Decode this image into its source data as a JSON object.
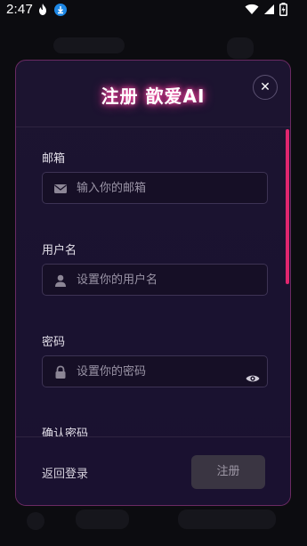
{
  "status_bar": {
    "time": "2:47",
    "app_icon": "flame-app-icon",
    "badge_icon": "download-badge-icon",
    "wifi_icon": "wifi-icon",
    "signal_icon": "cellular-signal-icon",
    "battery_icon": "battery-charging-icon"
  },
  "modal": {
    "title": "注册 歆爱AI",
    "close_label": "✕",
    "accent_color": "#ff2d95",
    "scrollbar_color": "#e0266e",
    "fields": [
      {
        "label": "邮箱",
        "placeholder": "输入你的邮箱",
        "icon": "envelope-icon"
      },
      {
        "label": "用户名",
        "placeholder": "设置你的用户名",
        "icon": "user-icon"
      },
      {
        "label": "密码",
        "placeholder": "设置你的密码",
        "icon": "lock-icon",
        "toggle_icon": "eye-icon"
      },
      {
        "label": "确认密码"
      }
    ],
    "footer": {
      "back_label": "返回登录",
      "submit_label": "注册"
    }
  }
}
